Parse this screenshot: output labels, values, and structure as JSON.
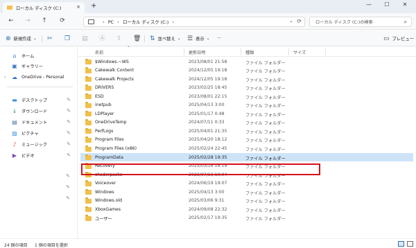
{
  "tab": {
    "title": "ローカル ディスク (C:)",
    "close": "×",
    "new": "+"
  },
  "window": {
    "minimize": "—",
    "maximize": "☐",
    "close": "✕"
  },
  "nav": {
    "back": "←",
    "forward": "→",
    "up": "↑",
    "refresh": "⟳"
  },
  "address": {
    "pc": "PC",
    "drive": "ローカル ディスク (C:)",
    "sep": "›"
  },
  "search": {
    "placeholder": "ローカル ディスク (C:)の検索"
  },
  "toolbar": {
    "new_label": "新規作成",
    "sort_label": "並べ替え",
    "view_label": "表示",
    "more": "···",
    "preview_label": "プレビュー"
  },
  "sidebar": {
    "items": [
      {
        "label": "ホーム",
        "icon": "home-icon"
      },
      {
        "label": "ギャラリー",
        "icon": "gallery-icon"
      },
      {
        "label": "OneDrive - Personal",
        "icon": "cloud-icon"
      },
      {
        "label": "デスクトップ",
        "icon": "desktop-icon"
      },
      {
        "label": "ダウンロード",
        "icon": "download-icon"
      },
      {
        "label": "ドキュメント",
        "icon": "document-icon"
      },
      {
        "label": "ピクチャ",
        "icon": "picture-icon"
      },
      {
        "label": "ミュージック",
        "icon": "music-icon"
      },
      {
        "label": "ビデオ",
        "icon": "video-icon"
      }
    ]
  },
  "columns": {
    "name": "名前",
    "date": "更新日時",
    "type": "種類",
    "size": "サイズ"
  },
  "files": [
    {
      "name": "$Windows.~WS",
      "date": "2023/08/01 21:58",
      "type": "ファイル フォルダー"
    },
    {
      "name": "Cakewalk Content",
      "date": "2024/12/05 19:18",
      "type": "ファイル フォルダー"
    },
    {
      "name": "Cakewalk Projects",
      "date": "2024/12/05 19:18",
      "type": "ファイル フォルダー"
    },
    {
      "name": "DRIVERS",
      "date": "2023/02/25 18:45",
      "type": "ファイル フォルダー"
    },
    {
      "name": "ESD",
      "date": "2023/08/01 22:15",
      "type": "ファイル フォルダー"
    },
    {
      "name": "inetpub",
      "date": "2025/04/13 3:00",
      "type": "ファイル フォルダー"
    },
    {
      "name": "LDPlayer",
      "date": "2025/01/17 0:48",
      "type": "ファイル フォルダー"
    },
    {
      "name": "OneDriveTemp",
      "date": "2024/07/11 0:33",
      "type": "ファイル フォルダー"
    },
    {
      "name": "PerfLogs",
      "date": "2025/04/01 21:35",
      "type": "ファイル フォルダー"
    },
    {
      "name": "Program Files",
      "date": "2025/04/20 18:12",
      "type": "ファイル フォルダー"
    },
    {
      "name": "Program Files (x86)",
      "date": "2025/02/24 22:45",
      "type": "ファイル フォルダー"
    },
    {
      "name": "ProgramData",
      "date": "2025/02/28 19:35",
      "type": "ファイル フォルダー"
    },
    {
      "name": "Recovery",
      "date": "2025/03/16 16:19",
      "type": "ファイル フォルダー"
    },
    {
      "name": "shaderpacks",
      "date": "2023/07/16 10:04",
      "type": "ファイル フォルダー"
    },
    {
      "name": "Voiceover",
      "date": "2024/06/19 19:07",
      "type": "ファイル フォルダー"
    },
    {
      "name": "Windows",
      "date": "2025/04/13 3:00",
      "type": "ファイル フォルダー"
    },
    {
      "name": "Windows.old",
      "date": "2025/03/06 9:31",
      "type": "ファイル フォルダー"
    },
    {
      "name": "XboxGames",
      "date": "2024/09/08 22:32",
      "type": "ファイル フォルダー"
    },
    {
      "name": "ユーザー",
      "date": "2025/02/17 19:35",
      "type": "ファイル フォルダー"
    }
  ],
  "selected_index": 11,
  "status": {
    "count": "24 個の項目",
    "selection": "1 個の項目を選択"
  },
  "colors": {
    "accent": "#2f6fb3",
    "selection": "#cde3f8",
    "highlight": "#d6111c",
    "folder": "#f0c04a"
  }
}
